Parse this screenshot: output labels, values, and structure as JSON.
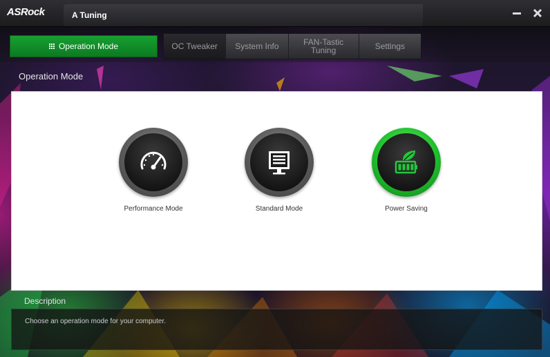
{
  "window": {
    "brand": "ASRock",
    "title": "A Tuning",
    "minimize_icon": "minimize-icon",
    "close_icon": "close-icon"
  },
  "nav": {
    "active_tab": "Operation Mode",
    "tabs": [
      {
        "label": "OC Tweaker"
      },
      {
        "label": "System Info"
      },
      {
        "label": "FAN-Tastic Tuning"
      },
      {
        "label": "Settings"
      }
    ],
    "accent": "#14a02e"
  },
  "main": {
    "section_title": "Operation Mode",
    "modes": [
      {
        "label": "Performance Mode",
        "icon": "speedometer-icon",
        "selected": false
      },
      {
        "label": "Standard Mode",
        "icon": "monitor-icon",
        "selected": false
      },
      {
        "label": "Power Saving",
        "icon": "battery-leaf-icon",
        "selected": true
      }
    ]
  },
  "description": {
    "title": "Description",
    "text": "Choose an operation mode for your computer."
  }
}
